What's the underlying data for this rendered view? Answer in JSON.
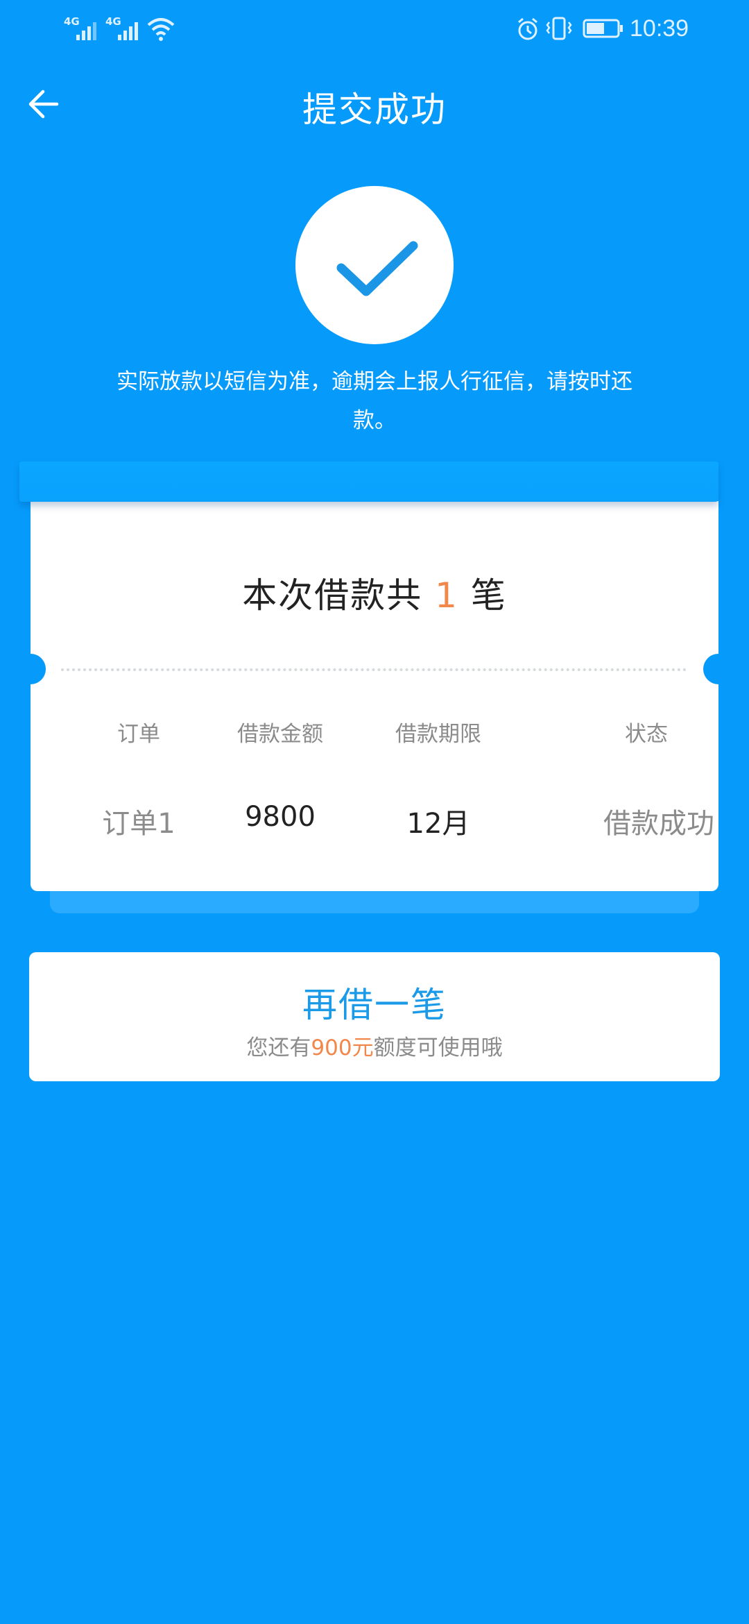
{
  "status_bar": {
    "network1": "4G",
    "network2": "4G",
    "time": "10:39",
    "battery_level": 0.6
  },
  "header": {
    "title": "提交成功"
  },
  "notice": "实际放款以短信为准，逾期会上报人行征信，请按时还款。",
  "card": {
    "summary_prefix": "本次借款共",
    "summary_count": "1",
    "summary_suffix": "笔",
    "columns": [
      "订单",
      "借款金额",
      "借款期限",
      "状态"
    ],
    "rows": [
      {
        "order": "订单1",
        "amount": "9800",
        "term": "12月",
        "status": "借款成功"
      }
    ]
  },
  "borrow_again": {
    "title": "再借一笔",
    "sub_prefix": "您还有",
    "sub_amount": "900元",
    "sub_suffix": "额度可使用哦"
  },
  "colors": {
    "background": "#069bfb",
    "accent_orange": "#f2874b",
    "link_blue": "#1b9ae8"
  }
}
